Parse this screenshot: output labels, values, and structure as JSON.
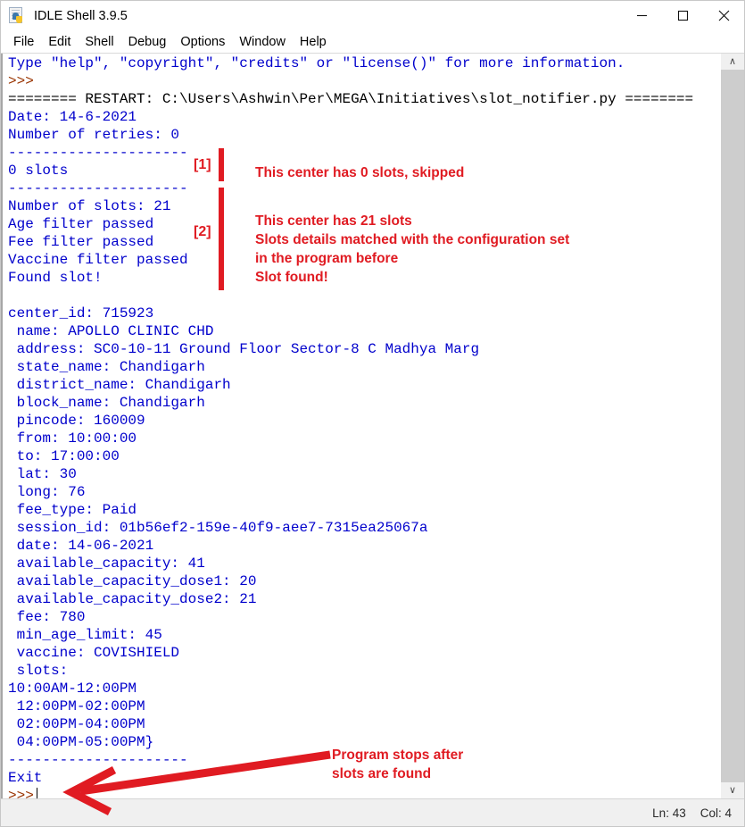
{
  "window": {
    "title": "IDLE Shell 3.9.5",
    "icon": "python-file-icon",
    "controls": {
      "minimize": "–",
      "maximize": "□",
      "close": "✕"
    }
  },
  "menu": {
    "items": [
      {
        "label": "File"
      },
      {
        "label": "Edit"
      },
      {
        "label": "Shell"
      },
      {
        "label": "Debug"
      },
      {
        "label": "Options"
      },
      {
        "label": "Window"
      },
      {
        "label": "Help"
      }
    ]
  },
  "shell": {
    "lines": [
      {
        "text": "Type \"help\", \"copyright\", \"credits\" or \"license()\" for more information.",
        "style": "out"
      },
      {
        "text": ">>>",
        "style": "prompt"
      },
      {
        "text": "======== RESTART: C:\\Users\\Ashwin\\Per\\MEGA\\Initiatives\\slot_notifier.py ========",
        "style": "black"
      },
      {
        "text": "Date: 14-6-2021",
        "style": "out"
      },
      {
        "text": "Number of retries: 0",
        "style": "out"
      },
      {
        "text": "---------------------",
        "style": "out"
      },
      {
        "text": "0 slots",
        "style": "out"
      },
      {
        "text": "---------------------",
        "style": "out"
      },
      {
        "text": "Number of slots: 21",
        "style": "out"
      },
      {
        "text": "Age filter passed",
        "style": "out"
      },
      {
        "text": "Fee filter passed",
        "style": "out"
      },
      {
        "text": "Vaccine filter passed",
        "style": "out"
      },
      {
        "text": "Found slot!",
        "style": "out"
      },
      {
        "text": "",
        "style": "out"
      },
      {
        "text": "center_id: 715923",
        "style": "out"
      },
      {
        "text": " name: APOLLO CLINIC CHD",
        "style": "out"
      },
      {
        "text": " address: SC0-10-11 Ground Floor Sector-8 C Madhya Marg",
        "style": "out"
      },
      {
        "text": " state_name: Chandigarh",
        "style": "out"
      },
      {
        "text": " district_name: Chandigarh",
        "style": "out"
      },
      {
        "text": " block_name: Chandigarh",
        "style": "out"
      },
      {
        "text": " pincode: 160009",
        "style": "out"
      },
      {
        "text": " from: 10:00:00",
        "style": "out"
      },
      {
        "text": " to: 17:00:00",
        "style": "out"
      },
      {
        "text": " lat: 30",
        "style": "out"
      },
      {
        "text": " long: 76",
        "style": "out"
      },
      {
        "text": " fee_type: Paid",
        "style": "out"
      },
      {
        "text": " session_id: 01b56ef2-159e-40f9-aee7-7315ea25067a",
        "style": "out"
      },
      {
        "text": " date: 14-06-2021",
        "style": "out"
      },
      {
        "text": " available_capacity: 41",
        "style": "out"
      },
      {
        "text": " available_capacity_dose1: 20",
        "style": "out"
      },
      {
        "text": " available_capacity_dose2: 21",
        "style": "out"
      },
      {
        "text": " fee: 780",
        "style": "out"
      },
      {
        "text": " min_age_limit: 45",
        "style": "out"
      },
      {
        "text": " vaccine: COVISHIELD",
        "style": "out"
      },
      {
        "text": " slots:",
        "style": "out"
      },
      {
        "text": "10:00AM-12:00PM",
        "style": "out"
      },
      {
        "text": " 12:00PM-02:00PM",
        "style": "out"
      },
      {
        "text": " 02:00PM-04:00PM",
        "style": "out"
      },
      {
        "text": " 04:00PM-05:00PM}",
        "style": "out"
      },
      {
        "text": "---------------------",
        "style": "out"
      },
      {
        "text": "Exit",
        "style": "out"
      },
      {
        "text": ">>>",
        "style": "prompt",
        "caret": true
      }
    ]
  },
  "annotations": {
    "color": "#e01b22",
    "marks": [
      {
        "tag": "[1]",
        "lines": [
          "This center has 0 slots, skipped"
        ]
      },
      {
        "tag": "[2]",
        "lines": [
          "This center has 21 slots",
          "Slots details matched with the configuration set",
          "in the program before",
          "Slot found!"
        ]
      }
    ],
    "arrow_note": [
      "Program stops after",
      "slots are found"
    ]
  },
  "scrollbar": {
    "up_arrow": "∧",
    "down_arrow": "∨"
  },
  "statusbar": {
    "line": "Ln: 43",
    "column": "Col: 4"
  }
}
